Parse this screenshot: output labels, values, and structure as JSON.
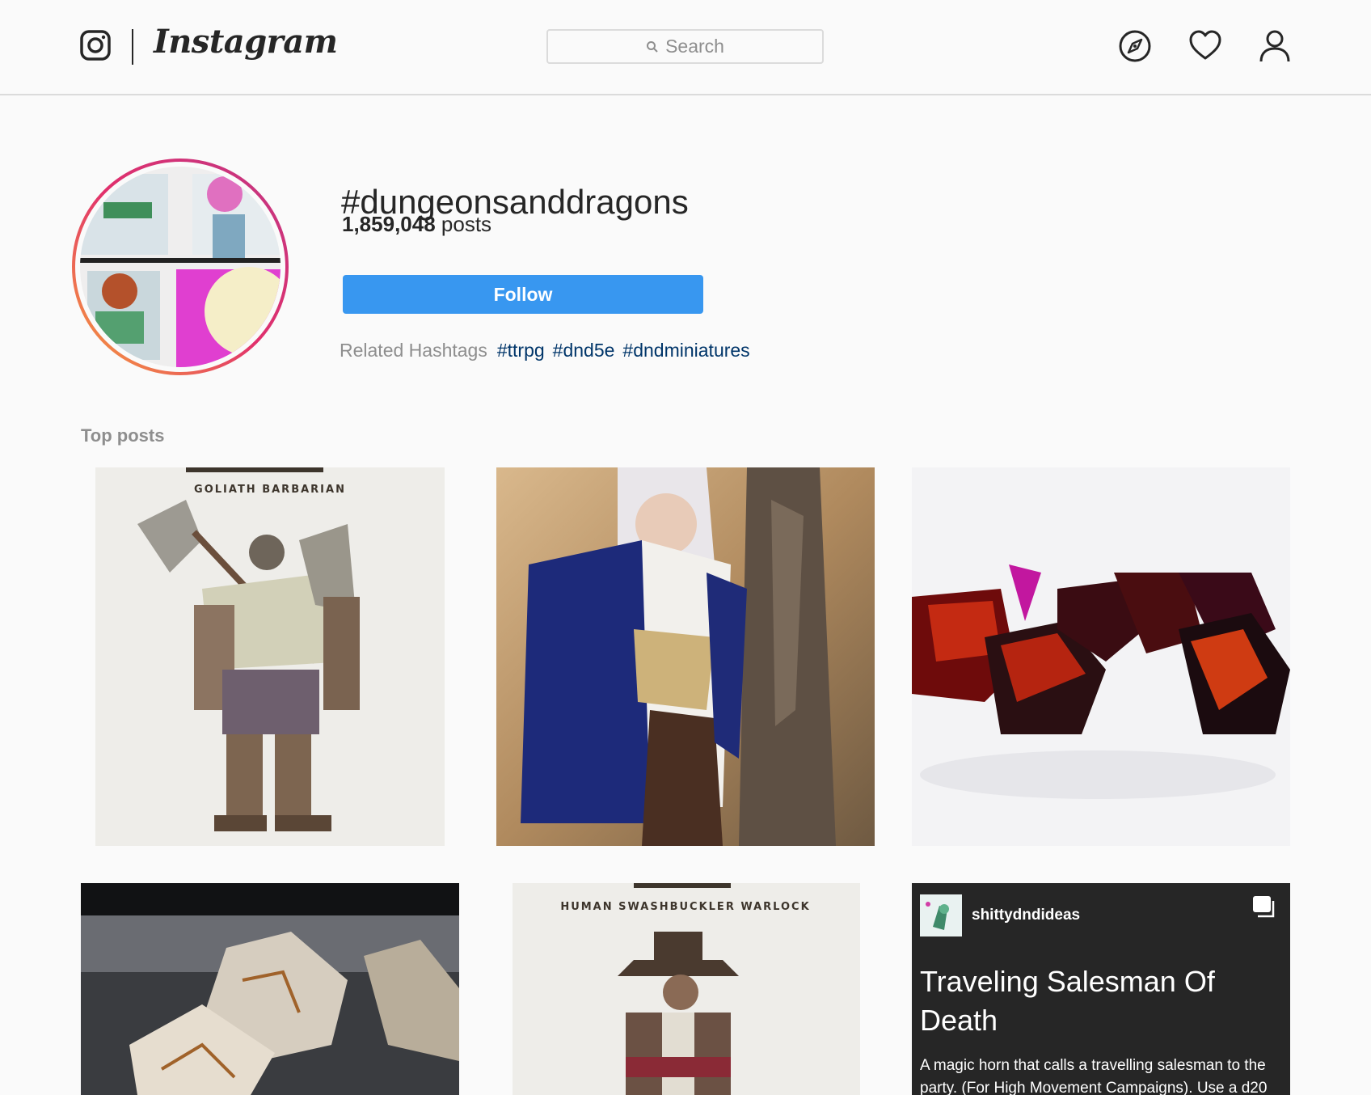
{
  "nav": {
    "wordmark": "Instagram",
    "search_placeholder": "Search",
    "icons": [
      "instagram-glyph-icon",
      "search-icon",
      "compass-icon",
      "heart-icon",
      "user-icon"
    ]
  },
  "header": {
    "hashtag": "#dungeonsanddragons",
    "post_count": "1,859,048",
    "post_count_suffix": "posts",
    "follow_label": "Follow",
    "related_label": "Related Hashtags",
    "related_tags": [
      "#ttrpg",
      "#dnd5e",
      "#dndminiatures"
    ]
  },
  "top_posts": {
    "title": "Top posts",
    "posts": [
      {
        "caption": "GOLIATH BARBARIAN"
      },
      {
        "caption": ""
      },
      {
        "caption": ""
      },
      {
        "caption": ""
      },
      {
        "caption": "HUMAN SWASHBUCKLER WARLOCK"
      },
      {
        "username": "shittydndideas",
        "title": "Traveling Salesman Of Death",
        "text": "A magic horn that calls a travelling salesman to the party. (For High Movement Campaigns). Use a d20"
      }
    ]
  },
  "colors": {
    "accent_blue": "#3897f0",
    "link_blue": "#003569",
    "text": "#262626",
    "muted": "#8e8e8e",
    "border": "#dbdbdb",
    "background": "#fafafa"
  }
}
